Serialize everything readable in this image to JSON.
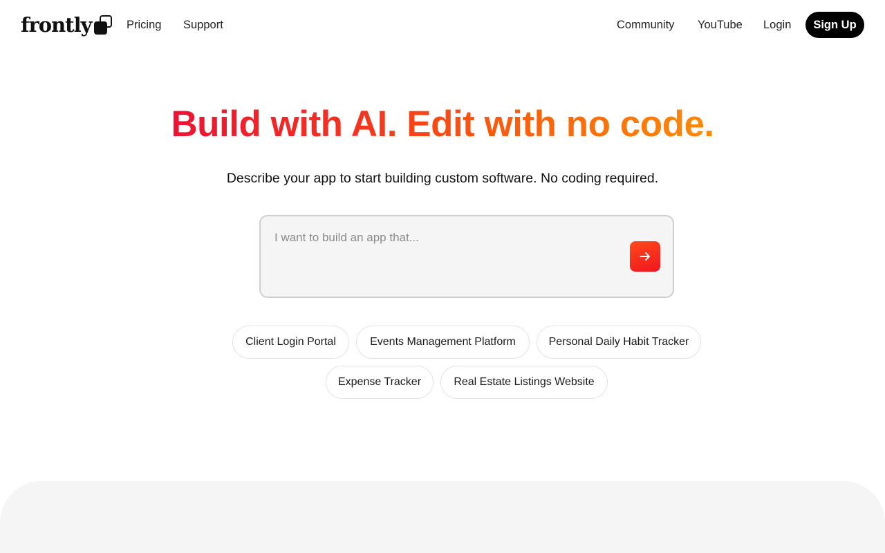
{
  "nav": {
    "logo_text": "frontly",
    "left_links": [
      "Pricing",
      "Support"
    ],
    "right_links": [
      "Community",
      "YouTube",
      "Login"
    ],
    "signup_label": "Sign Up"
  },
  "hero": {
    "title": "Build with AI. Edit with no code.",
    "subtitle": "Describe your app to start building custom software. No coding required."
  },
  "prompt": {
    "placeholder": "I want to build an app that...",
    "value": ""
  },
  "suggestions": [
    "Client Login Portal",
    "Events Management Platform",
    "Personal Daily Habit Tracker",
    "Expense Tracker",
    "Real Estate Listings Website"
  ],
  "colors": {
    "accent_start": "#ee1234",
    "accent_end": "#fc8b07",
    "submit_button": "#f5251c",
    "signup_bg": "#000000",
    "input_bg": "#f5f5f5"
  },
  "icons": {
    "submit": "arrow-right-icon",
    "logo": "overlapping-squares-icon"
  }
}
